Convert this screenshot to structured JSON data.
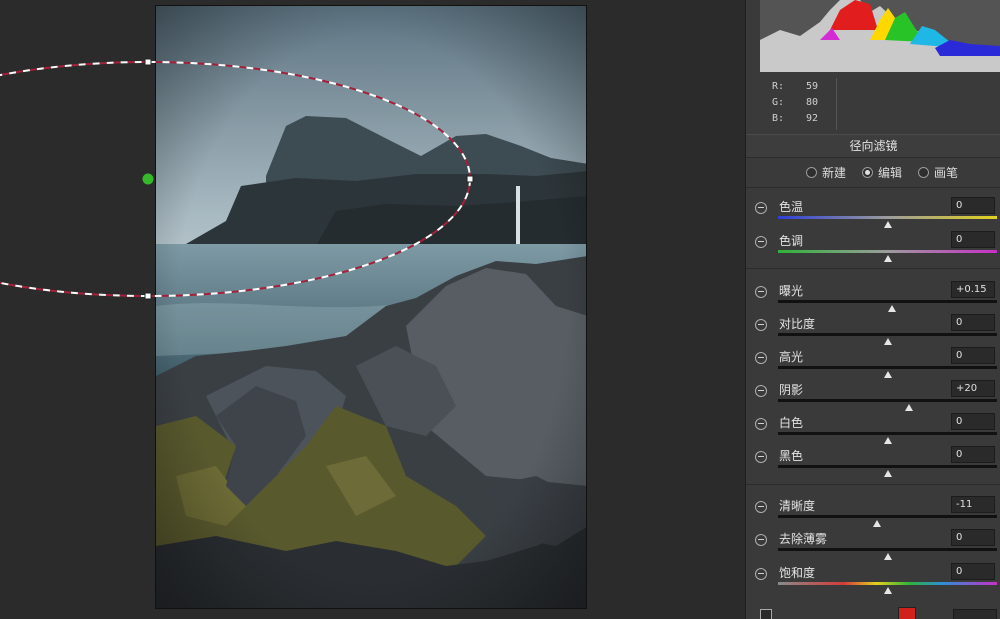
{
  "rgb": [
    {
      "key": "R:",
      "value": "59"
    },
    {
      "key": "G:",
      "value": "80"
    },
    {
      "key": "B:",
      "value": "92"
    }
  ],
  "panel_title": "径向滤镜",
  "modes": [
    {
      "label": "新建",
      "selected": false
    },
    {
      "label": "编辑",
      "selected": true
    },
    {
      "label": "画笔",
      "selected": false
    }
  ],
  "sliders": [
    {
      "id": "temp",
      "label": "色温",
      "value": "0",
      "position": 0.5,
      "track": "temp"
    },
    {
      "id": "tint",
      "label": "色调",
      "value": "0",
      "position": 0.5,
      "track": "tint"
    },
    {
      "id": "exposure",
      "label": "曝光",
      "value": "+0.15",
      "position": 0.52,
      "track": "gray"
    },
    {
      "id": "contrast",
      "label": "对比度",
      "value": "0",
      "position": 0.5,
      "track": "gray"
    },
    {
      "id": "highlights",
      "label": "高光",
      "value": "0",
      "position": 0.5,
      "track": "gray"
    },
    {
      "id": "shadows",
      "label": "阴影",
      "value": "+20",
      "position": 0.6,
      "track": "gray"
    },
    {
      "id": "whites",
      "label": "白色",
      "value": "0",
      "position": 0.5,
      "track": "gray"
    },
    {
      "id": "blacks",
      "label": "黑色",
      "value": "0",
      "position": 0.5,
      "track": "gray"
    },
    {
      "id": "clarity",
      "label": "清晰度",
      "value": "-11",
      "position": 0.45,
      "track": "gray"
    },
    {
      "id": "dehaze",
      "label": "去除薄雾",
      "value": "0",
      "position": 0.5,
      "track": "gray"
    },
    {
      "id": "saturation",
      "label": "饱和度",
      "value": "0",
      "position": 0.5,
      "track": "sat"
    }
  ],
  "colors": {
    "panel_bg": "#3a3a3a",
    "canvas_bg": "#2b2b2b",
    "filter_dash_red": "#a3213a",
    "pin_green": "#35b82a",
    "swatch_red": "#d0221b"
  },
  "icons": [
    "minus-circle-icon",
    "radio-icon",
    "filter-pin-icon",
    "resize-handle-icon"
  ]
}
